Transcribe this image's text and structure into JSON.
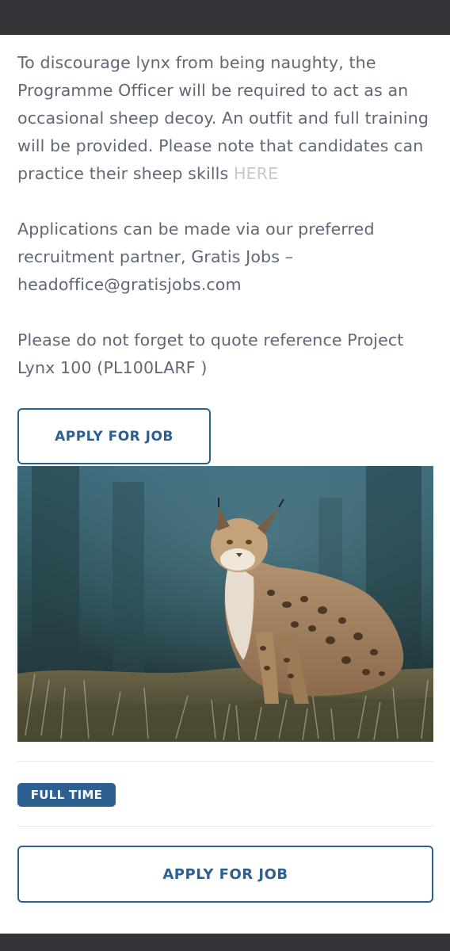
{
  "body": {
    "paragraph1": {
      "text": "To discourage lynx from being naughty, the Programme Officer will be required to act as an occasional sheep decoy.  An outfit and full training will be provided.  Please note that candidates can practice their sheep skills ",
      "link_label": "HERE"
    },
    "paragraph2": "Applications can be made via our preferred recruitment partner, Gratis Jobs – headoffice@gratisjobs.com",
    "paragraph3": "Please do not forget to quote reference Project Lynx 100 (PL100LARF )"
  },
  "actions": {
    "apply_label": "APPLY FOR JOB"
  },
  "job": {
    "type_badge": "FULL TIME"
  },
  "colors": {
    "accent": "#2e5f91",
    "body_text": "#5f6875",
    "link_muted": "#c4c9cf",
    "system_bar": "#333437"
  }
}
